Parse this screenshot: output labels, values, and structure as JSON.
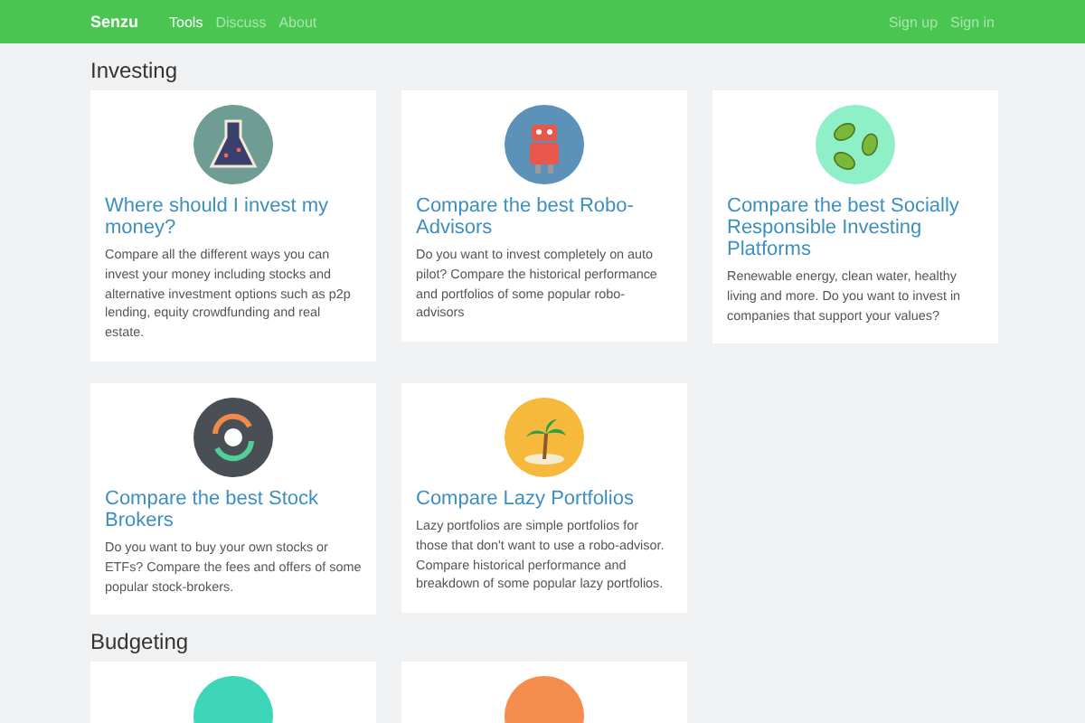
{
  "navbar": {
    "brand": "Senzu",
    "links": [
      {
        "label": "Tools",
        "selected": true
      },
      {
        "label": "Discuss",
        "selected": false
      },
      {
        "label": "About",
        "selected": false
      }
    ],
    "account_links": [
      "Sign up",
      "Sign in"
    ]
  },
  "sections": [
    {
      "heading": "Investing",
      "cards": [
        {
          "kind": "flask",
          "title": "Where should I invest my money?",
          "text": "Compare all the different ways you can invest your money including stocks and alternative investment options such as p2p lending, equity crowdfunding and real estate."
        },
        {
          "kind": "robot",
          "title": "Compare the best Robo-Advisors",
          "text": "Do you want to invest completely on auto pilot? Compare the historical performance and portfolios of some popular robo-advisors"
        },
        {
          "kind": "leaves",
          "title": "Compare the best Socially Responsible Investing Platforms",
          "text": "Renewable energy, clean water, healthy living and more. Do you want to invest in companies that support your values?"
        },
        {
          "kind": "exchange",
          "title": "Compare the best Stock Brokers",
          "text": "Do you want to buy your own stocks or ETFs? Compare the fees and offers of some popular stock-brokers."
        },
        {
          "kind": "palm",
          "title": "Compare Lazy Portfolios",
          "text": "Lazy portfolios are simple portfolios for those that don't want to use a robo-advisor. Compare historical performance and breakdown of some popular lazy portfolios."
        }
      ]
    },
    {
      "heading": "Budgeting",
      "cards": [
        {
          "kind": "teal"
        },
        {
          "kind": "orange"
        }
      ]
    }
  ]
}
